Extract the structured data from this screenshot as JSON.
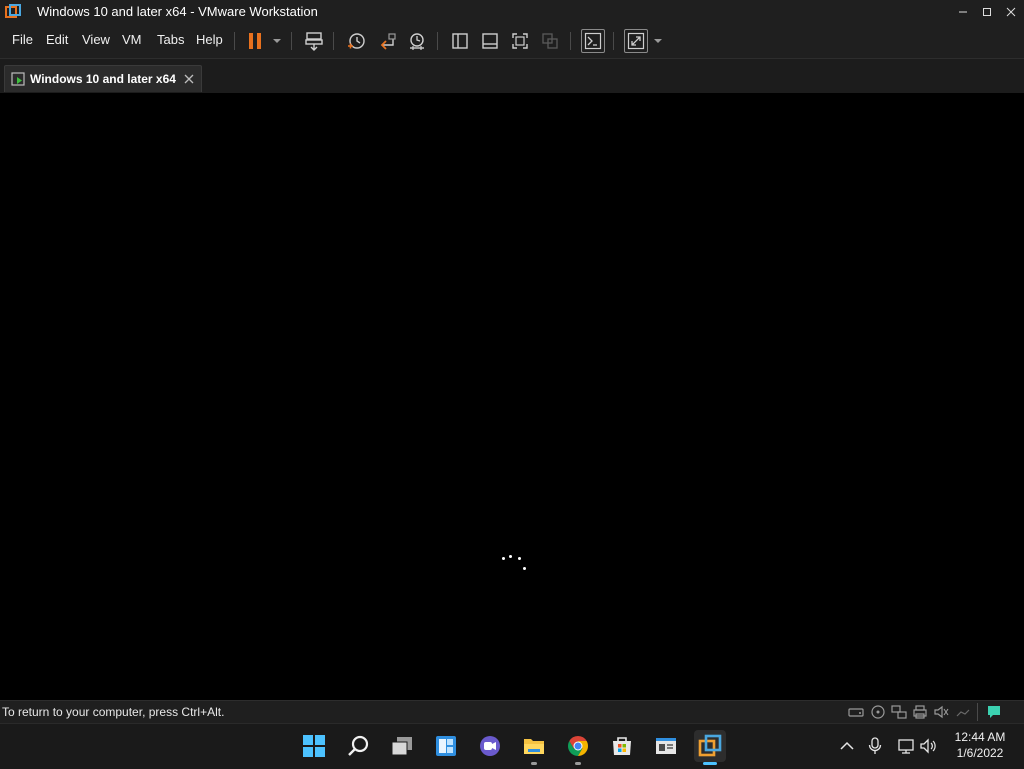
{
  "window": {
    "title": "Windows 10 and later x64 - VMware Workstation",
    "controls": [
      "minimize",
      "maximize",
      "close"
    ]
  },
  "menubar": {
    "items": [
      "File",
      "Edit",
      "View",
      "VM",
      "Tabs",
      "Help"
    ]
  },
  "toolbar": {
    "icons": [
      "pause-icon",
      "dropdown-icon",
      "send-ctrl-alt-del-icon",
      "snapshot-take-icon",
      "snapshot-revert-icon",
      "snapshot-manager-icon",
      "show-library-icon",
      "show-thumbnail-bar-icon",
      "full-screen-icon",
      "unity-icon",
      "console-view-icon",
      "stretch-guest-icon",
      "dropdown-icon"
    ],
    "accent": "#e8711e"
  },
  "tabs": [
    {
      "label": "Windows 10 and later x64",
      "active": true
    }
  ],
  "console": {
    "state": "booting",
    "spinner": "loading-dots"
  },
  "statusbar": {
    "message": "To return to your computer, press Ctrl+Alt.",
    "devices": [
      "hard-disk-icon",
      "cd-dvd-icon",
      "network-adapter-icon",
      "usb-icon",
      "printer-icon",
      "sound-card-icon",
      "display-icon",
      "message-log-icon"
    ]
  },
  "taskbar": {
    "apps": [
      "start-icon",
      "search-icon",
      "task-view-icon",
      "widgets-icon",
      "teams-chat-icon",
      "file-explorer-icon",
      "chrome-icon",
      "microsoft-store-icon",
      "vmware-app-icon",
      "vmware-workstation-icon"
    ],
    "tray": [
      "show-hidden-icons-icon",
      "microphone-icon",
      "network-icon",
      "volume-icon"
    ],
    "time": "12:44 AM",
    "date": "1/6/2022"
  }
}
